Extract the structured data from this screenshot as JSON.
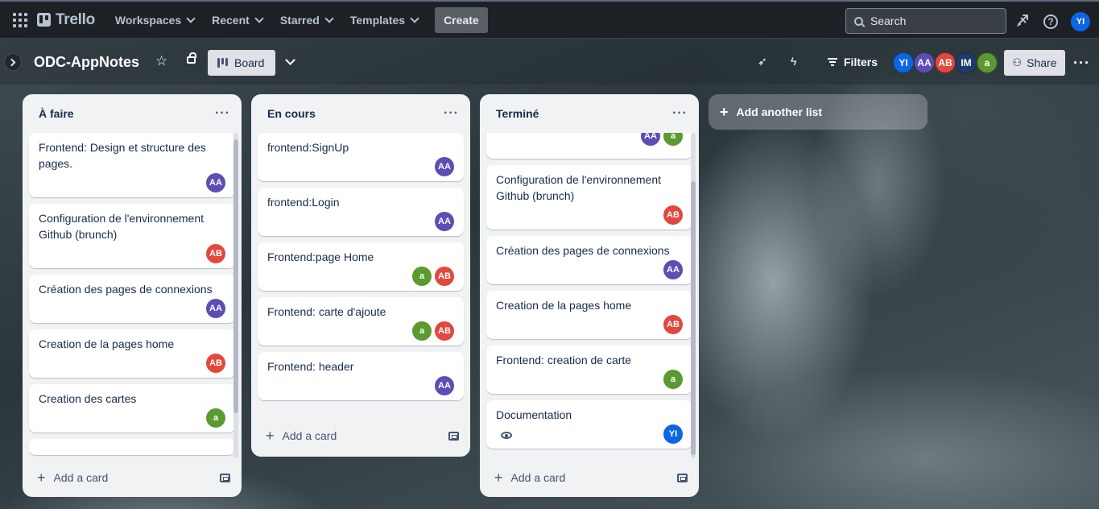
{
  "topnav": {
    "app_name": "Trello",
    "menus": [
      {
        "label": "Workspaces"
      },
      {
        "label": "Recent"
      },
      {
        "label": "Starred"
      },
      {
        "label": "Templates"
      }
    ],
    "create_label": "Create",
    "search_placeholder": "Search",
    "user_initials": "YI",
    "icons": [
      "apps-grid-icon",
      "trello-logo-icon",
      "notifications-icon",
      "help-icon",
      "search-icon"
    ]
  },
  "board": {
    "title": "ODC-AppNotes",
    "view_label": "Board",
    "filters_label": "Filters",
    "share_label": "Share",
    "members": [
      {
        "initials": "YI",
        "color": "#0c66e4"
      },
      {
        "initials": "AA",
        "color": "#5e4db2"
      },
      {
        "initials": "AB",
        "color": "#e2483d"
      },
      {
        "initials": "IM",
        "color": "#1f3b6e"
      },
      {
        "initials": "a",
        "color": "#5b9a30"
      }
    ],
    "add_list_label": "Add another list"
  },
  "colors": {
    "AA": "#5e4db2",
    "AB": "#e2483d",
    "a": "#5b9a30",
    "YI": "#0c66e4"
  },
  "lists": [
    {
      "title": "À faire",
      "add_card_label": "Add a card",
      "cards": [
        {
          "text": "Frontend: Design et structure des pages.",
          "members": [
            "AA"
          ]
        },
        {
          "text": "Configuration de l'environnement Github (brunch)",
          "members": [
            "AB"
          ]
        },
        {
          "text": "Création des pages de connexions",
          "members": [
            "AA"
          ]
        },
        {
          "text": "Creation de la pages home",
          "members": [
            "AB"
          ]
        },
        {
          "text": "Creation des cartes",
          "members": [
            "a"
          ]
        }
      ]
    },
    {
      "title": "En cours",
      "add_card_label": "Add a card",
      "cards": [
        {
          "text": "frontend:SignUp",
          "members": [
            "AA"
          ]
        },
        {
          "text": "frontend:Login",
          "members": [
            "AA"
          ]
        },
        {
          "text": "Frontend:page Home",
          "members": [
            "a",
            "AB"
          ]
        },
        {
          "text": "Frontend: carte d'ajoute",
          "members": [
            "a",
            "AB"
          ]
        },
        {
          "text": "Frontend: header",
          "members": [
            "AA"
          ]
        }
      ]
    },
    {
      "title": "Terminé",
      "add_card_label": "Add a card",
      "cards": [
        {
          "text": "",
          "members": [
            "AA",
            "a"
          ]
        },
        {
          "text": "Configuration de l'environnement Github (brunch)",
          "members": [
            "AB"
          ]
        },
        {
          "text": "Création des pages de connexions",
          "members": [
            "AA"
          ]
        },
        {
          "text": "Creation de la pages home",
          "members": [
            "AB"
          ]
        },
        {
          "text": "Frontend: creation de carte",
          "members": [
            "a"
          ]
        },
        {
          "text": "Documentation",
          "members": [
            "YI"
          ],
          "watching": true
        }
      ]
    }
  ]
}
